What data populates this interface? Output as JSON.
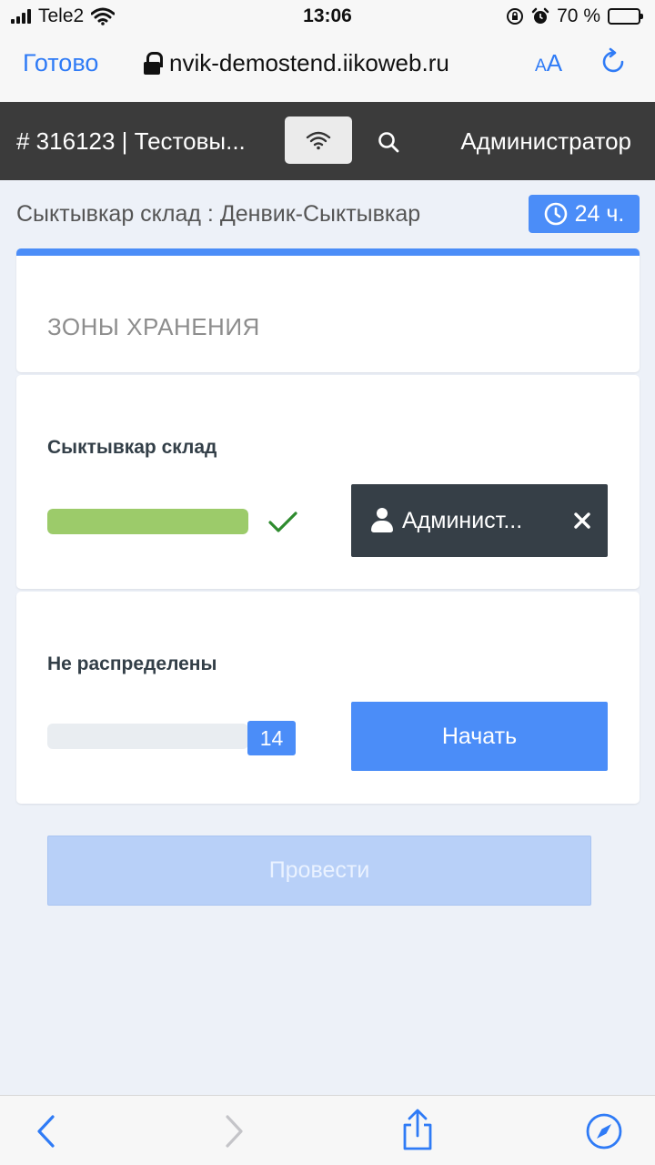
{
  "status_bar": {
    "carrier": "Tele2",
    "time": "13:06",
    "battery": "70 %",
    "battery_level": 0.7
  },
  "browser": {
    "done_label": "Готово",
    "url": "nvik-demostend.iikoweb.ru",
    "text_size_small": "A",
    "text_size_large": "A"
  },
  "header": {
    "order_title": "# 316123 | Тестовы...",
    "user_link": "Администратор"
  },
  "location": {
    "title": "Сыктывкар склад : Денвик-Сыктывкар",
    "hours_badge": "24 ч."
  },
  "zones": {
    "section_title": "ЗОНЫ ХРАНЕНИЯ",
    "items": [
      {
        "name": "Сыктывкар склад",
        "progress": 1.0,
        "assigned_user": "Админист..."
      },
      {
        "name": "Не распределены",
        "progress": 0.0,
        "count": "14",
        "start_label": "Начать"
      }
    ]
  },
  "actions": {
    "submit_label": "Провести"
  },
  "colors": {
    "accent": "#4b8df8",
    "header_bg": "#3b3b3b",
    "success": "#9ccb6a",
    "check": "#2e8b2e",
    "dark_button": "#363f47",
    "ios_blue": "#2f7bf6"
  },
  "icons": {
    "toolbar": [
      "back-icon",
      "forward-icon",
      "share-icon",
      "compass-icon"
    ]
  }
}
